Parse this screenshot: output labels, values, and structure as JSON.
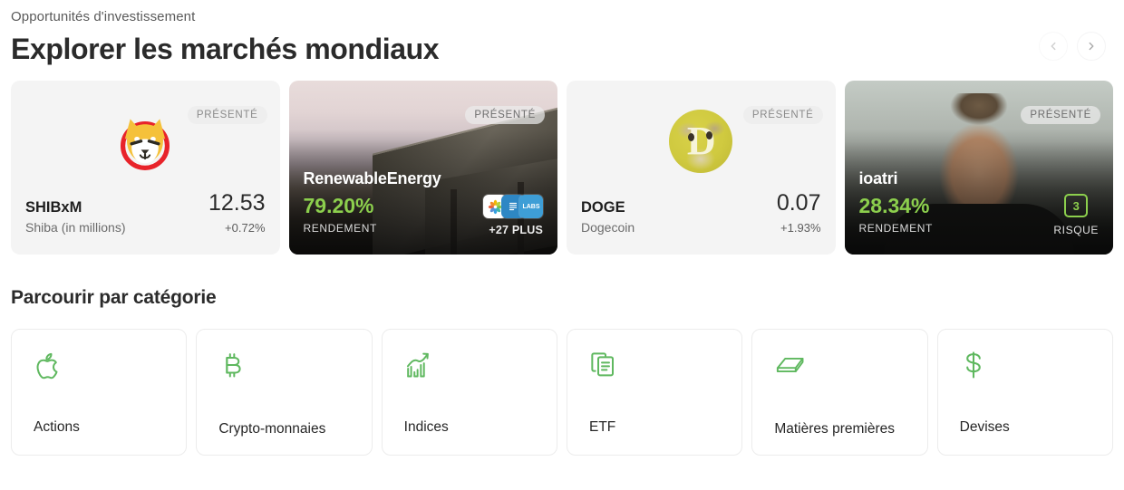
{
  "header": {
    "eyebrow": "Opportunités d'investissement",
    "title": "Explorer les marchés mondiaux",
    "prev_icon": "chevron-left-icon",
    "next_icon": "chevron-right-icon"
  },
  "featured": {
    "badge_label": "PRÉSENTÉ",
    "cards": [
      {
        "type": "coin",
        "icon": "shiba-inu-logo",
        "symbol": "SHIBxM",
        "name": "Shiba (in millions)",
        "price": "12.53",
        "change": "+0.72%"
      },
      {
        "type": "media",
        "background": "solar-panels-sunset-photo",
        "title": "RenewableEnergy",
        "yield": "79.20%",
        "yield_label": "RENDEMENT",
        "extra_label": "+27 PLUS",
        "app_icons": [
          "photos-icon",
          "document-icon",
          "labs-icon"
        ]
      },
      {
        "type": "coin",
        "icon": "dogecoin-logo",
        "symbol": "DOGE",
        "name": "Dogecoin",
        "price": "0.07",
        "change": "+1.93%"
      },
      {
        "type": "media",
        "background": "investor-portrait-photo",
        "title": "ioatri",
        "yield": "28.34%",
        "yield_label": "RENDEMENT",
        "risk_value": "3",
        "risk_label": "RISQUE"
      }
    ]
  },
  "categories": {
    "title": "Parcourir par catégorie",
    "items": [
      {
        "label": "Actions",
        "icon": "apple-icon"
      },
      {
        "label": "Crypto-monnaies",
        "icon": "bitcoin-icon"
      },
      {
        "label": "Indices",
        "icon": "chart-growth-icon"
      },
      {
        "label": "ETF",
        "icon": "documents-icon"
      },
      {
        "label": "Matières premières",
        "icon": "gold-bar-icon"
      },
      {
        "label": "Devises",
        "icon": "dollar-sign-icon"
      }
    ]
  },
  "colors": {
    "accent_green": "#8ccf4d",
    "icon_green": "#5fb85f",
    "text_dark": "#2b2b2b",
    "text_muted": "#6c6c6c",
    "card_light_bg": "#f4f4f4"
  }
}
